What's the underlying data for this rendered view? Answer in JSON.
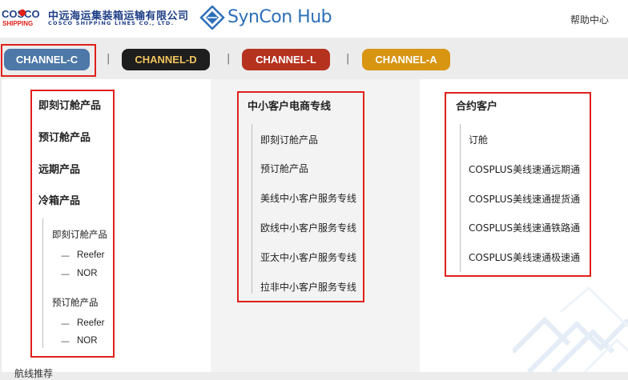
{
  "header": {
    "logo_brand": "COSCO SHIPPING",
    "logo_cn": "中远海运集装箱运输有限公司",
    "logo_en": "COSCO SHIPPING LINES CO., LTD.",
    "app_name": "SynCon Hub",
    "help_link": "帮助中心"
  },
  "tabs": [
    {
      "label": "CHANNEL-C",
      "color": "#4d78a8"
    },
    {
      "label": "CHANNEL-D",
      "color": "#1e1e1e"
    },
    {
      "label": "CHANNEL-L",
      "color": "#b5321e"
    },
    {
      "label": "CHANNEL-A",
      "color": "#d79512"
    }
  ],
  "separator": "|",
  "col1": {
    "items": [
      "即刻订舱产品",
      "预订舱产品",
      "远期产品",
      "冷箱产品"
    ],
    "reefer_groups": [
      {
        "label": "即刻订舱产品",
        "subs": [
          "Reefer",
          "NOR"
        ]
      },
      {
        "label": "预订舱产品",
        "subs": [
          "Reefer",
          "NOR"
        ]
      }
    ]
  },
  "col2": {
    "title": "中小客户电商专线",
    "items": [
      "即刻订舱产品",
      "预订舱产品",
      "美线中小客户服务专线",
      "欧线中小客户服务专线",
      "亚太中小客户服务专线",
      "拉非中小客户服务专线"
    ]
  },
  "col3": {
    "title": "合约客户",
    "items": [
      "订舱",
      "COSPLUS美线速通远期通",
      "COSPLUS美线速通提货通",
      "COSPLUS美线速通铁路通",
      "COSPLUS美线速通极速通"
    ]
  },
  "bottom_text": "航线推荐",
  "colors": {
    "highlight": "#e0201a",
    "tab_d_text": "#f2c55f"
  }
}
